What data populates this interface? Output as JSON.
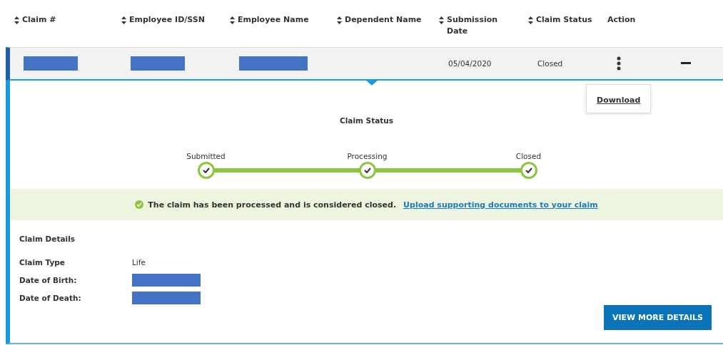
{
  "columns": [
    {
      "label": "Claim #",
      "sortable": true
    },
    {
      "label": "Employee ID/SSN",
      "sortable": true
    },
    {
      "label": "Employee Name",
      "sortable": true
    },
    {
      "label": "Dependent Name",
      "sortable": true
    },
    {
      "label": "Submission Date",
      "sortable": true
    },
    {
      "label": "Claim Status",
      "sortable": true
    },
    {
      "label": "Action",
      "sortable": false
    }
  ],
  "row": {
    "expanded": true,
    "cells": [
      {
        "kind": "redacted"
      },
      {
        "kind": "redacted"
      },
      {
        "kind": "redacted"
      },
      {
        "kind": "empty"
      },
      {
        "kind": "text",
        "text": "05/04/2020"
      },
      {
        "kind": "text",
        "text": "Closed"
      }
    ],
    "action_menu": {
      "open": true,
      "items": [
        "Download"
      ]
    }
  },
  "status": {
    "title": "Claim Status",
    "steps": [
      {
        "label": "Submitted",
        "done": true
      },
      {
        "label": "Processing",
        "done": true
      },
      {
        "label": "Closed",
        "done": true
      }
    ],
    "message": "The claim has been processed and is considered closed.",
    "link": "Upload supporting documents to your claim"
  },
  "details": {
    "title": "Claim Details",
    "fields": [
      {
        "label": "Claim Type",
        "kind": "text",
        "value": "Life"
      },
      {
        "label": "Date of Birth:",
        "kind": "redacted"
      },
      {
        "label": "Date of Death:",
        "kind": "redacted"
      }
    ]
  },
  "button": "VIEW MORE DETAILS"
}
